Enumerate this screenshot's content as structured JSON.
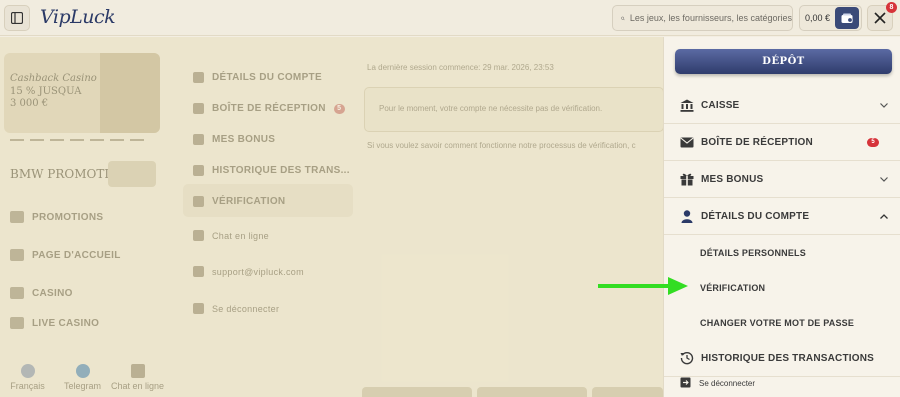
{
  "header": {
    "logo_text": "VipLuck",
    "search_placeholder": "Les jeux, les fournisseurs, les catégories",
    "balance": "0,00 €",
    "notification_count": "8"
  },
  "background": {
    "promo_line1": "Cashback Casino",
    "promo_line2": "15 % JUSQUA",
    "promo_line3": "3 000 €",
    "bmw_label": "BMW PROMOTION",
    "left_nav": [
      "PROMOTIONS",
      "PAGE D'ACCUEIL",
      "CASINO",
      "LIVE CASINO"
    ],
    "bottom_tabs": [
      "Français",
      "Telegram",
      "Chat en ligne"
    ],
    "account_nav": [
      {
        "label": "DÉTAILS DU COMPTE"
      },
      {
        "label": "BOÎTE DE RÉCEPTION",
        "badge": "5"
      },
      {
        "label": "MES BONUS"
      },
      {
        "label": "HISTORIQUE DES TRANS..."
      },
      {
        "label": "VÉRIFICATION"
      }
    ],
    "account_links": [
      "Chat en ligne",
      "support@vipluck.com",
      "Se déconnecter"
    ],
    "session_text": "La dernière session commence: 29 mar. 2026, 23:53",
    "verification_msg": "Pour le moment, votre compte ne nécessite pas de vérification.",
    "how_text": "Si vous voulez savoir comment fonctionne notre processus de vérification, c"
  },
  "panel": {
    "deposit_label": "DÉPÔT",
    "items": [
      {
        "label": "CAISSE",
        "icon": "bank-icon"
      },
      {
        "label": "BOÎTE DE RÉCEPTION",
        "icon": "mail-icon",
        "badge": "5"
      },
      {
        "label": "MES BONUS",
        "icon": "gift-icon"
      },
      {
        "label": "DÉTAILS DU COMPTE",
        "icon": "user-icon"
      }
    ],
    "subitems": [
      "DÉTAILS PERSONNELS",
      "VÉRIFICATION",
      "CHANGER VOTRE MOT DE PASSE"
    ],
    "history_label": "HISTORIQUE DES TRANSACTIONS",
    "logout_label": "Se déconnecter"
  },
  "colors": {
    "accent": "#2f3c6c",
    "badge": "#d6333a",
    "arrow": "#33dd22"
  }
}
